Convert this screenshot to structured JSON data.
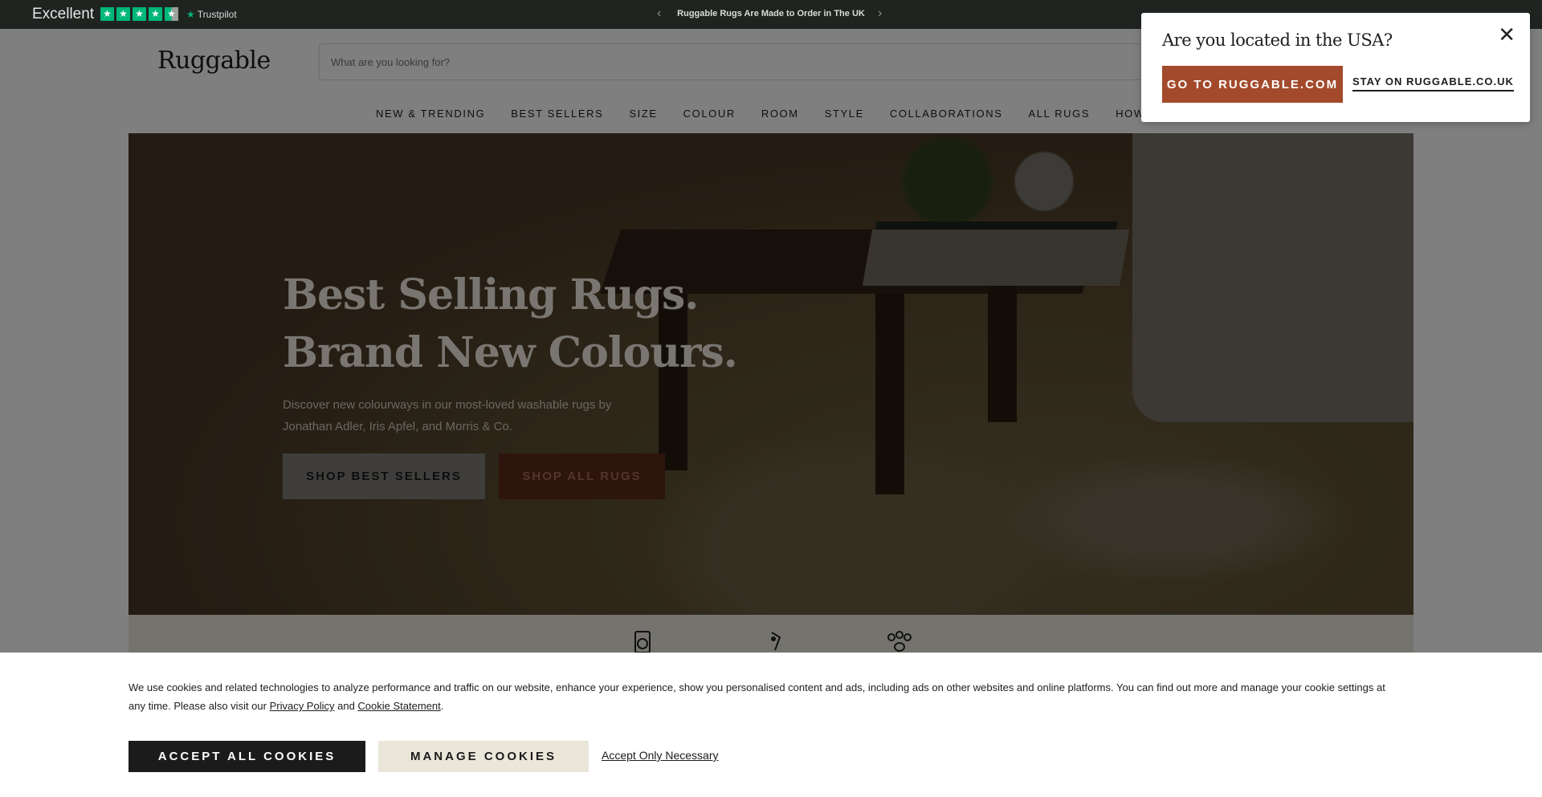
{
  "topbar": {
    "rating_word": "Excellent",
    "trustpilot_label": "Trustpilot",
    "announcement": "Ruggable Rugs Are Made to Order in The UK",
    "prev_icon": "chevron-left-icon",
    "next_icon": "chevron-right-icon"
  },
  "header": {
    "logo": "Ruggable",
    "search_placeholder": "What are you looking for?",
    "nav": [
      "NEW & TRENDING",
      "BEST SELLERS",
      "SIZE",
      "COLOUR",
      "ROOM",
      "STYLE",
      "COLLABORATIONS",
      "ALL RUGS",
      "HOW IT WO"
    ]
  },
  "hero": {
    "title_line1": "Best Selling Rugs.",
    "title_line2": "Brand New Colours.",
    "subtitle": "Discover new colourways in our most-loved washable rugs by Jonathan Adler, Iris Apfel, and Morris & Co.",
    "cta_primary": "SHOP BEST SELLERS",
    "cta_secondary": "SHOP ALL RUGS"
  },
  "benefits": {
    "icons": [
      "washing-machine-icon",
      "spill-icon",
      "paw-icon"
    ]
  },
  "location_popup": {
    "question": "Are you located in the USA?",
    "go_label": "GO TO RUGGABLE.COM",
    "stay_label": "STAY ON RUGGABLE.CO.UK",
    "close_icon": "close-icon"
  },
  "cookie_banner": {
    "text_before": "We use cookies and related technologies to analyze performance and traffic on our website, enhance your experience, show you personalised content and ads, including ads on other websites and online platforms. You can find out more and manage your cookie settings at any time. Please also visit our ",
    "privacy_link": "Privacy Policy",
    "text_and": " and ",
    "cookie_link": "Cookie Statement",
    "text_end": ".",
    "accept_all": "ACCEPT ALL COOKIES",
    "manage": "MANAGE COOKIES",
    "accept_necessary": "Accept Only Necessary"
  },
  "colors": {
    "brand_rust": "#a34a2c",
    "topbar_bg": "#1f2420",
    "trustpilot_green": "#00b67a"
  }
}
